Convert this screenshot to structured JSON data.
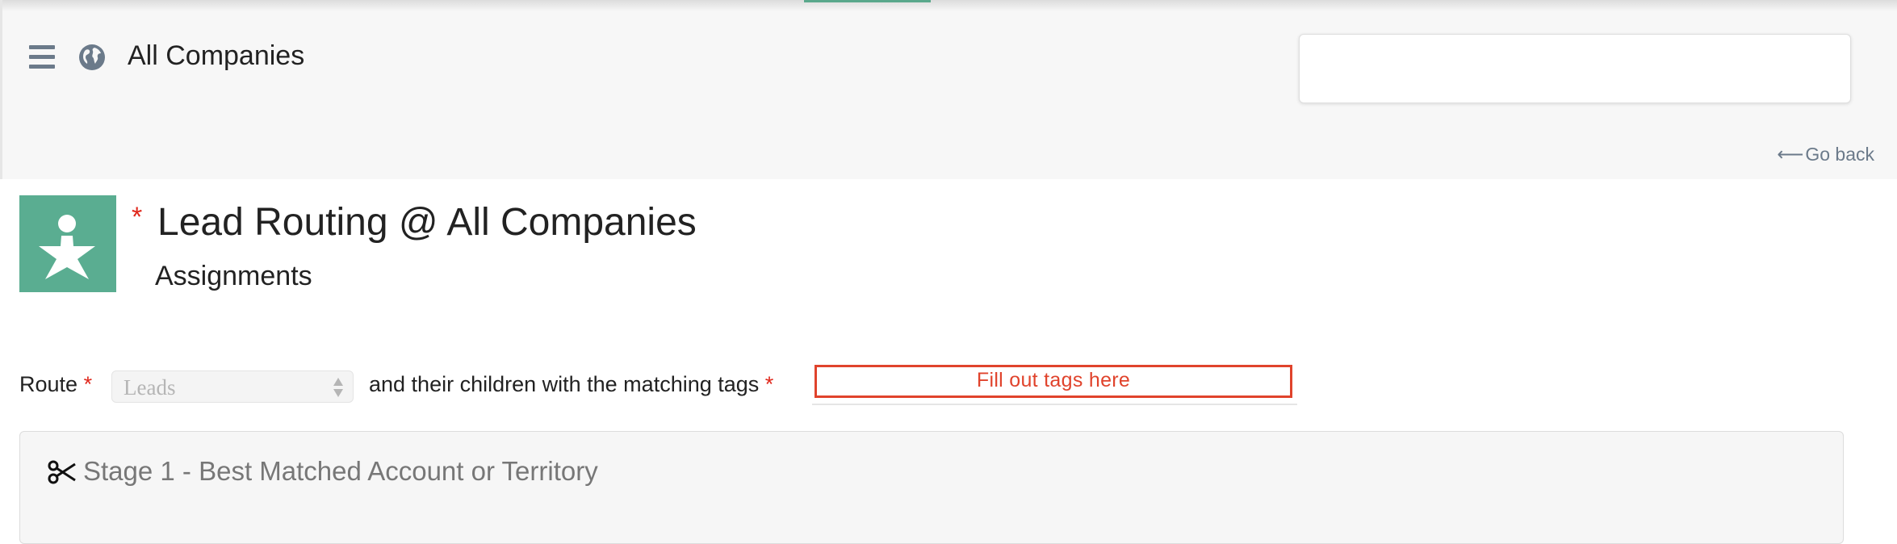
{
  "header": {
    "menu_icon": "hamburger-menu-icon",
    "globe_icon": "globe-icon",
    "title": "All Companies",
    "search": {
      "value": "",
      "placeholder": ""
    },
    "go_back_arrow": "⟵",
    "go_back_label": "Go back"
  },
  "page": {
    "logo_icon": "person-star-icon",
    "required_mark": "*",
    "title": "Lead Routing @ All Companies",
    "subtitle": "Assignments"
  },
  "route": {
    "label": "Route",
    "required_mark": "*",
    "select_value": "Leads",
    "children_label": "and their children with the matching tags",
    "tags_placeholder": "Fill out tags here"
  },
  "stage": {
    "icon": "scissors-icon",
    "title": "Stage 1 - Best Matched Account or Territory"
  },
  "colors": {
    "accent": "#5aad91",
    "required": "#e0281c",
    "error": "#e0432c",
    "muted": "#6b7a8a"
  }
}
